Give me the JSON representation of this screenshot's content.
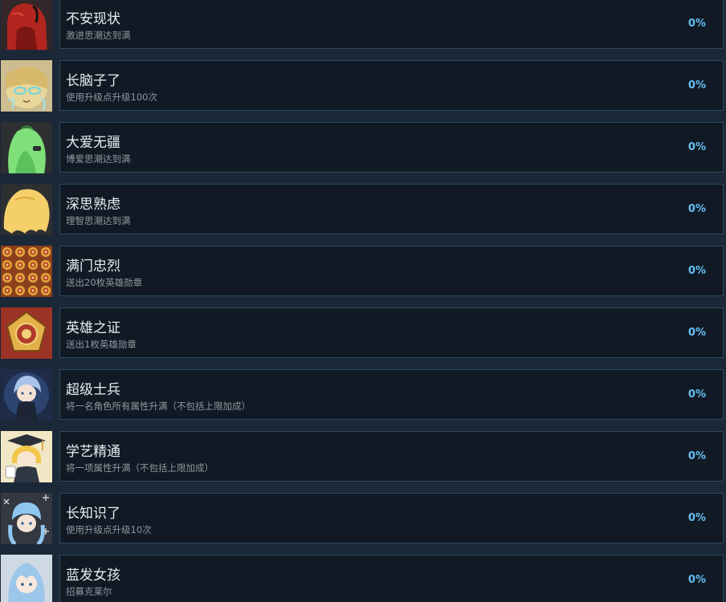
{
  "achievements": [
    {
      "title": "不安现状",
      "description": "激进思潮达到满",
      "percent": "0%",
      "icon": "red-hooded-character-icon",
      "bg": "#33272a"
    },
    {
      "title": "长脑子了",
      "description": "使用升级点升级100次",
      "percent": "0%",
      "icon": "glowing-brain-character-icon",
      "bg": "#cdbd90"
    },
    {
      "title": "大爱无疆",
      "description": "博爱思潮达到满",
      "percent": "0%",
      "icon": "green-hair-character-icon",
      "bg": "#2d2f31"
    },
    {
      "title": "深思熟虑",
      "description": "理智思潮达到满",
      "percent": "0%",
      "icon": "blonde-hair-character-icon",
      "bg": "#2d2f31"
    },
    {
      "title": "满门忠烈",
      "description": "送出20枚英雄勋章",
      "percent": "0%",
      "icon": "medal-pattern-icon",
      "bg": "#8c3f1c"
    },
    {
      "title": "英雄之证",
      "description": "送出1枚英雄勋章",
      "percent": "0%",
      "icon": "hero-medal-icon",
      "bg": "#9c3327"
    },
    {
      "title": "超级士兵",
      "description": "将一名角色所有属性升满（不包括上限加成）",
      "percent": "0%",
      "icon": "soldier-character-icon",
      "bg": "#1e2c4a"
    },
    {
      "title": "学艺精通",
      "description": "将一项属性升满（不包括上限加成）",
      "percent": "0%",
      "icon": "graduate-character-icon",
      "bg": "#f1e7c5"
    },
    {
      "title": "长知识了",
      "description": "使用升级点升级10次",
      "percent": "0%",
      "icon": "chalkboard-character-icon",
      "bg": "#333841"
    },
    {
      "title": "蓝发女孩",
      "description": "招募克莱尔",
      "percent": "0%",
      "icon": "blue-hair-girl-icon",
      "bg": "#cfd9e4"
    }
  ]
}
